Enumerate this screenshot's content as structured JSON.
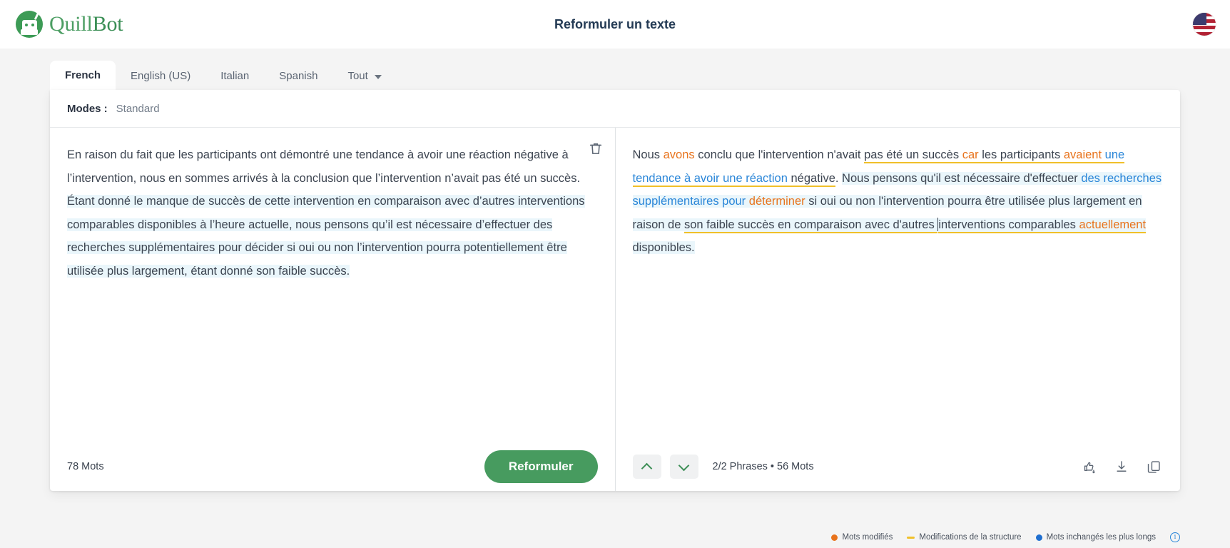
{
  "header": {
    "brand_first": "Quill",
    "brand_second": "Bot",
    "title": "Reformuler un texte",
    "flag_icon": "us-flag-icon"
  },
  "tabs": [
    {
      "label": "French",
      "active": true
    },
    {
      "label": "English (US)",
      "active": false
    },
    {
      "label": "Italian",
      "active": false
    },
    {
      "label": "Spanish",
      "active": false
    },
    {
      "label": "Tout",
      "active": false,
      "icon": "chevron-down-icon"
    }
  ],
  "modes": {
    "label": "Modes :",
    "selected": "Standard"
  },
  "input": {
    "text": "En raison du fait que les participants ont démontré une tendance à avoir une réaction négative à l’intervention, nous en sommes arrivés à la conclusion que l’intervention n’avait pas été un succès. Étant donné le manque de succès de cette intervention en comparaison avec d’autres interventions comparables disponibles à l’heure actuelle, nous pensons qu’il est nécessaire d’effectuer des recherches supplémentaires pour décider si oui ou non l’intervention pourra potentiellement être utilisée plus largement, étant donné son faible succès.",
    "part_plain": "En raison du fait que les participants ont démontré une tendance à avoir une réaction négative à l’intervention, nous en sommes arrivés à la conclusion que l’intervention n’avait pas été un succès. ",
    "part_highlighted": "Étant donné le manque de succès de cette intervention en comparaison avec d’autres interventions comparables disponibles à l’heure actuelle, nous pensons qu’il est nécessaire d’effectuer des recherches supplémentaires pour décider si oui ou non l’intervention pourra potentiellement être utilisée plus largement, étant donné son faible succès.",
    "word_count": "78 Mots",
    "clear_icon": "trash-icon",
    "rephrase_button": "Reformuler"
  },
  "output": {
    "segments": [
      {
        "text": "Nous ",
        "style": "plain"
      },
      {
        "text": "avons",
        "style": "orange"
      },
      {
        "text": " conclu que l'intervention n'avait ",
        "style": "plain"
      },
      {
        "text": "pas été un succès ",
        "style": "underline"
      },
      {
        "text": "car",
        "style": "orange-underline"
      },
      {
        "text": " les participants ",
        "style": "underline"
      },
      {
        "text": "avaient",
        "style": "orange-underline"
      },
      {
        "text": " ",
        "style": "underline"
      },
      {
        "text": "une tendance à avoir une réaction",
        "style": "blue-underline"
      },
      {
        "text": " négative",
        "style": "underline"
      },
      {
        "text": ". ",
        "style": "plain"
      },
      {
        "text": "Nous pensons qu'il est nécessaire d'effectuer ",
        "style": "hl"
      },
      {
        "text": "des recherches supplémentaires pour",
        "style": "hl-blue"
      },
      {
        "text": " ",
        "style": "hl"
      },
      {
        "text": "déterminer",
        "style": "hl-orange"
      },
      {
        "text": " si oui ou non l'intervention pourra être utilisée plus largement en raison de ",
        "style": "hl"
      },
      {
        "text": "son faible succès en comparaison avec d'autres ",
        "style": "hl-underline"
      },
      {
        "text": "CARET",
        "style": "caret"
      },
      {
        "text": "interventions comparables ",
        "style": "hl-underline"
      },
      {
        "text": "actuellement",
        "style": "hl-orange-underline"
      },
      {
        "text": " disponibles.",
        "style": "hl"
      }
    ],
    "full_text": "Nous avons conclu que l'intervention n'avait pas été un succès car les participants avaient une tendance à avoir une réaction négative. Nous pensons qu'il est nécessaire d'effectuer des recherches supplémentaires pour déterminer si oui ou non l'intervention pourra être utilisée plus largement en raison de son faible succès en comparaison avec d'autres interventions comparables actuellement disponibles.",
    "sentence_info": "2/2 Phrases • 56 Mots",
    "nav_up_icon": "chevron-up-icon",
    "nav_down_icon": "chevron-down-icon",
    "thumbs_icon": "thumbs-up-down-icon",
    "download_icon": "download-icon",
    "copy_icon": "copy-icon"
  },
  "legend": {
    "items": [
      {
        "marker": "dot",
        "color": "#e8731c",
        "label": "Mots modifiés"
      },
      {
        "marker": "dash",
        "color": "#f0c02a",
        "label": "Modifications de la structure"
      },
      {
        "marker": "dot",
        "color": "#1f6fd0",
        "label": "Mots inchangés les plus longs"
      }
    ],
    "info_icon": "info-icon",
    "info_label": "i"
  },
  "colors": {
    "accent_green": "#479b5f",
    "changed_word": "#e8731c",
    "unchanged_word": "#2a86d8",
    "structure": "#f0c02a",
    "highlight_bg": "#eaf6fb"
  }
}
